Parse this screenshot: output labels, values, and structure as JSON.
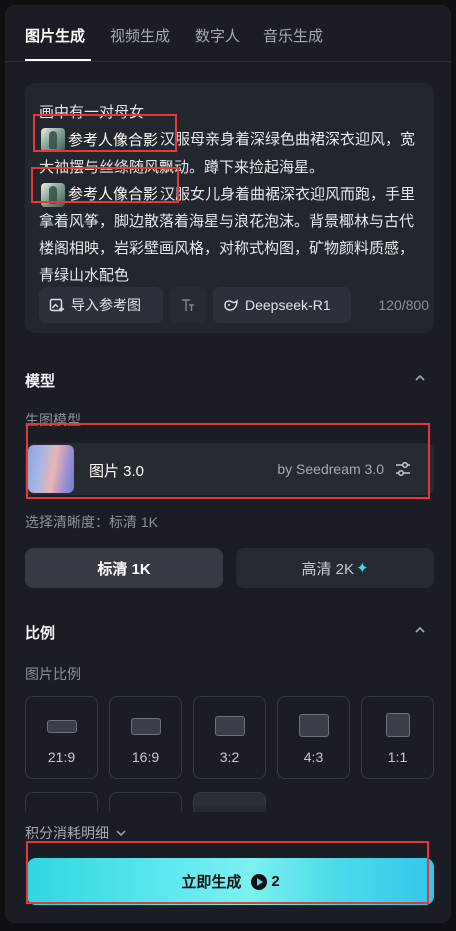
{
  "tabs": [
    {
      "label": "图片生成",
      "active": true
    },
    {
      "label": "视频生成",
      "active": false
    },
    {
      "label": "数字人",
      "active": false
    },
    {
      "label": "音乐生成",
      "active": false
    }
  ],
  "prompt": {
    "line1": "画中有一对母女",
    "ref1_label": "参考人像合影",
    "segment1": "汉服母亲身着深绿色曲裙深衣迎风，宽大袖摆与丝绦随风飘动。蹲下来捡起海星。",
    "ref2_label": "参考人像合影",
    "segment2": "汉服女儿身着曲裾深衣迎风而跑，手里拿着风筝，脚边散落着海星与浪花泡沫。背景椰林与古代楼阁相映，岩彩壁画风格，对称式构图，矿物颜料质感，青绿山水配色",
    "import_ref_label": "导入参考图",
    "model_chip_label": "Deepseek-R1",
    "counter": "120/800"
  },
  "model_section": {
    "title": "模型",
    "sub_label": "生图模型",
    "model_name": "图片 3.0",
    "model_by": "by Seedream 3.0",
    "resolution_label": "选择清晰度：标清 1K",
    "quality_options": [
      {
        "label": "标清 1K",
        "active": true
      },
      {
        "label": "高清 2K",
        "active": false
      }
    ]
  },
  "ratio_section": {
    "title": "比例",
    "sub_label": "图片比例",
    "ratios": [
      {
        "label": "21:9",
        "ratio": 2.333
      },
      {
        "label": "16:9",
        "ratio": 1.778
      },
      {
        "label": "3:2",
        "ratio": 1.5
      },
      {
        "label": "4:3",
        "ratio": 1.333
      },
      {
        "label": "1:1",
        "ratio": 1.0
      }
    ]
  },
  "footer": {
    "cost_detail_label": "积分消耗明细",
    "generate_label": "立即生成",
    "credit_cost": "2"
  },
  "colors": {
    "accent": "#4ddbe9",
    "highlight_box": "#e53935",
    "panel_bg": "#1a1d23"
  }
}
